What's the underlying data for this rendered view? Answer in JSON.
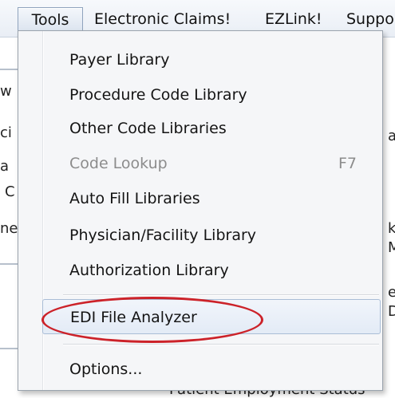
{
  "menubar": {
    "items": [
      "Tools",
      "Electronic Claims!",
      "EZLink!",
      "Suppo"
    ]
  },
  "background": {
    "fragments": [
      "w",
      "ci",
      "a",
      "C",
      "ne",
      "a",
      "k",
      "M",
      "ec",
      "D",
      "Patient Employment Status"
    ]
  },
  "tools_menu": {
    "items": [
      {
        "label": "Payer Library"
      },
      {
        "label": "Procedure Code Library"
      },
      {
        "label": "Other Code Libraries"
      },
      {
        "label": "Code Lookup",
        "shortcut": "F7",
        "disabled": true
      },
      {
        "label": "Auto Fill Libraries"
      },
      {
        "label": "Physician/Facility Library"
      },
      {
        "label": "Authorization Library"
      },
      {
        "label": "EDI File Analyzer",
        "highlighted": true,
        "circled": true
      },
      {
        "label": "Options..."
      }
    ]
  },
  "colors": {
    "annotation_circle": "#cc2229",
    "highlight_border": "#a9bdd6",
    "disabled_text": "#8c8c8c"
  }
}
